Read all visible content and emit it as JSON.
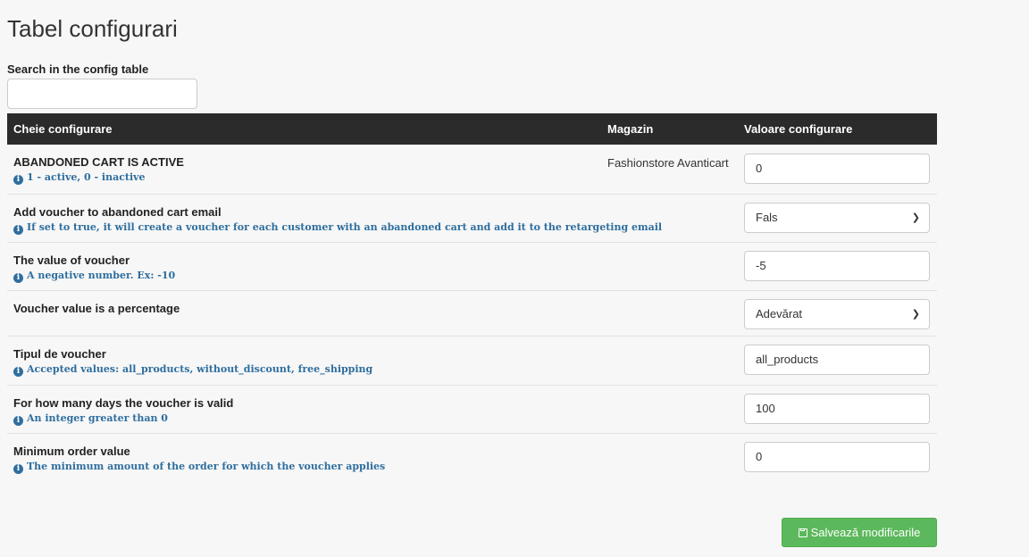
{
  "page_title": "Tabel configurari",
  "search": {
    "label": "Search in the config table",
    "value": "",
    "placeholder": ""
  },
  "table": {
    "headers": {
      "key": "Cheie configurare",
      "store": "Magazin",
      "value": "Valoare configurare"
    },
    "rows": [
      {
        "name": "ABANDONED CART IS ACTIVE",
        "help": "1 - active, 0 - inactive",
        "store": "Fashionstore Avanticart",
        "value": "0",
        "control": "input"
      },
      {
        "name": "Add voucher to abandoned cart email",
        "help": "If set to true, it will create a voucher for each customer with an abandoned cart and add it to the retargeting email",
        "store": "",
        "value": "Fals",
        "control": "select"
      },
      {
        "name": "The value of voucher",
        "help": "A negative number. Ex: -10",
        "store": "",
        "value": "-5",
        "control": "input"
      },
      {
        "name": "Voucher value is a percentage",
        "help": "",
        "store": "",
        "value": "Adevărat",
        "control": "select"
      },
      {
        "name": "Tipul de voucher",
        "help": "Accepted values: all_products, without_discount, free_shipping",
        "store": "",
        "value": "all_products",
        "control": "input"
      },
      {
        "name": "For how many days the voucher is valid",
        "help": "An integer greater than 0",
        "store": "",
        "value": "100",
        "control": "input"
      },
      {
        "name": "Minimum order value",
        "help": "The minimum amount of the order for which the voucher applies",
        "store": "",
        "value": "0",
        "control": "input"
      }
    ]
  },
  "save_button": {
    "label": "Salvează modificarile",
    "icon": "floppy-disk-icon",
    "color": "#5cb85c"
  },
  "colors": {
    "header_bg": "#2b2b2b",
    "help_text": "#2e6e9e",
    "page_bg": "#f7f7f7"
  },
  "icons": {
    "info": "info-circle-icon",
    "select_arrow": "chevron-down-icon"
  }
}
